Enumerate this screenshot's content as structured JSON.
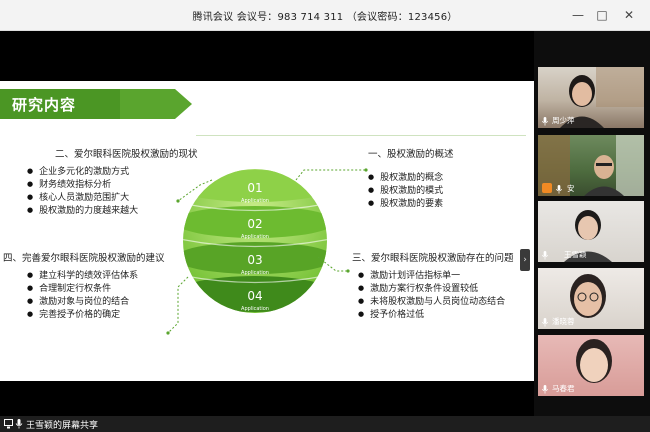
{
  "window": {
    "title": "腾讯会议  会议号：983 714 311  （会议密码：123456）"
  },
  "slide": {
    "title": "研究内容",
    "accent_color": "#5aa52e",
    "circle_layers": [
      {
        "num": "01",
        "caption": "Application"
      },
      {
        "num": "02",
        "caption": "Application"
      },
      {
        "num": "03",
        "caption": "Application"
      },
      {
        "num": "04",
        "caption": "Application"
      }
    ],
    "sections": {
      "s1": {
        "title": "一、股权激励的概述",
        "items": [
          "股权激励的概念",
          "股权激励的模式",
          "股权激励的要素"
        ]
      },
      "s2": {
        "title": "二、爱尔眼科医院股权激励的现状",
        "items": [
          "企业多元化的激励方式",
          "财务绩效指标分析",
          "核心人员激励范围扩大",
          "股权激励的力度越来越大"
        ]
      },
      "s3": {
        "title": "三、爱尔眼科医院股权激励存在的问题",
        "items": [
          "激励计划评估指标单一",
          "激励方案行权条件设置较低",
          "未将股权激励与人员岗位动态结合",
          "授予价格过低"
        ]
      },
      "s4": {
        "title": "四、完善爱尔眼科医院股权激励的建议",
        "items": [
          "建立科学的绩效评估体系",
          "合理制定行权条件",
          "激励对象与岗位的结合",
          "完善授予价格的确定"
        ]
      }
    }
  },
  "participants": [
    {
      "name": "周少萍",
      "muted": false
    },
    {
      "name": "安",
      "muted": false
    },
    {
      "name": "王雪颖",
      "muted": false
    },
    {
      "name": "潘晓蓉",
      "muted": false
    },
    {
      "name": "马春君",
      "muted": false
    }
  ],
  "status": {
    "sharing_text": "王雪颖的屏幕共享"
  },
  "icons": {
    "minimize": "minimize-icon",
    "maximize": "maximize-icon",
    "close": "close-icon",
    "collapse": "chevron-right-icon",
    "mic": "mic-icon"
  }
}
